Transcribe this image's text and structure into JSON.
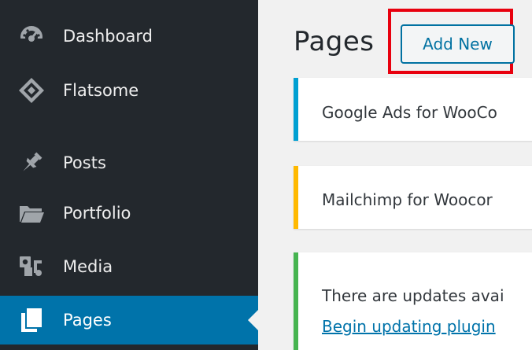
{
  "colors": {
    "sidebar_bg": "#23282d",
    "sidebar_current_bg": "#0073aa",
    "content_bg": "#f1f1f1",
    "notice_info": "#00a0d2",
    "notice_warning": "#ffb900",
    "notice_success": "#46b450",
    "link": "#0073aa",
    "highlight": "#e8000e"
  },
  "sidebar": {
    "items": [
      {
        "label": "Dashboard",
        "icon": "dashboard-icon"
      },
      {
        "label": "Flatsome",
        "icon": "flatsome-icon"
      },
      {
        "label": "Posts",
        "icon": "pin-icon"
      },
      {
        "label": "Portfolio",
        "icon": "folder-icon"
      },
      {
        "label": "Media",
        "icon": "media-icon"
      },
      {
        "label": "Pages",
        "icon": "page-icon",
        "current": true
      }
    ]
  },
  "main": {
    "title": "Pages",
    "add_new_label": "Add New",
    "notices": [
      {
        "text": "Google Ads for WooCo",
        "type": "info"
      },
      {
        "text": "Mailchimp for Woocor",
        "type": "warning"
      },
      {
        "text": "There are updates avai",
        "link": "Begin updating plugin",
        "type": "success"
      }
    ]
  }
}
